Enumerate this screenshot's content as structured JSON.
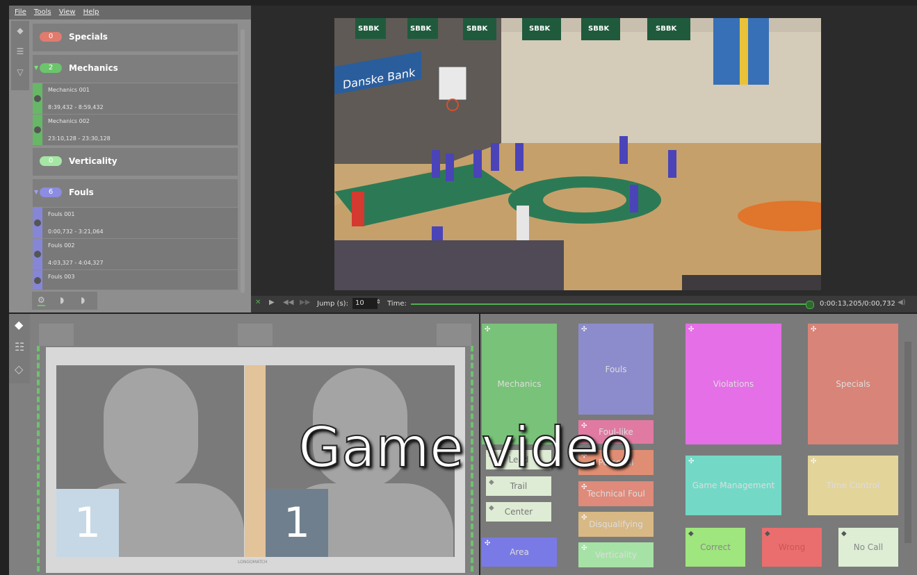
{
  "menu": [
    "File",
    "Tools",
    "View",
    "Help"
  ],
  "categories": [
    {
      "badge": "0",
      "name": "Specials",
      "color": "#e07b6e"
    },
    {
      "badge": "2",
      "name": "Mechanics",
      "color": "#6cc46c"
    },
    {
      "badge": "0",
      "name": "Verticality",
      "color": "#a5e6a5"
    },
    {
      "badge": "6",
      "name": "Fouls",
      "color": "#8c8ce0"
    }
  ],
  "events": [
    {
      "name": "Mechanics 001",
      "time": "8:39,432 - 8:59,432",
      "color": "#66b866"
    },
    {
      "name": "Mechanics 002",
      "time": "23:10,128 - 23:30,128",
      "color": "#66b866"
    },
    {
      "name": "Fouls 001",
      "time": "0:00,732 - 3:21,064",
      "color": "#8686d6"
    },
    {
      "name": "Fouls 002",
      "time": "4:03,327 - 4:04,327",
      "color": "#8686d6"
    },
    {
      "name": "Fouls 003",
      "time": "",
      "color": "#8686d6"
    }
  ],
  "controls": {
    "jump_label": "Jump (s):",
    "jump_value": "10",
    "time_label": "Time:",
    "time_readout": "0:00:13,205/0:00,732"
  },
  "video": {
    "banners": [
      "SBBK",
      "SBBK",
      "SBBK",
      "SBBK",
      "SBBK",
      "SBBK"
    ],
    "sponsor": "Danske Bank"
  },
  "court": {
    "left_number": "1",
    "right_number": "1",
    "logo": "LONGOMATCH"
  },
  "tag_buttons": [
    {
      "id": "mechanics",
      "label": "Mechanics",
      "color": "#79c279"
    },
    {
      "id": "fouls",
      "label": "Fouls",
      "color": "#8c8ccc"
    },
    {
      "id": "violations",
      "label": "Violations",
      "color": "#e56fe6"
    },
    {
      "id": "specials",
      "label": "Specials",
      "color": "#d98478"
    },
    {
      "id": "foul-like",
      "label": "Foul-like",
      "color": "#e07aa2"
    },
    {
      "id": "personal",
      "label": "Personal",
      "color": "#e08e73"
    },
    {
      "id": "technical-foul",
      "label": "Technical Foul",
      "color": "#df8a7a"
    },
    {
      "id": "disqualifying",
      "label": "Disqualifying",
      "color": "#d8b884"
    },
    {
      "id": "verticality",
      "label": "Verticality",
      "color": "#a6e2a6"
    },
    {
      "id": "game-management",
      "label": "Game Management",
      "color": "#73d9c6"
    },
    {
      "id": "time-control",
      "label": "Time Control",
      "color": "#e3d49a"
    },
    {
      "id": "area",
      "label": "Area",
      "color": "#7a7ae6"
    }
  ],
  "position_tags": [
    {
      "label": "Lead"
    },
    {
      "label": "Trail"
    },
    {
      "label": "Center"
    }
  ],
  "result_tags": [
    {
      "label": "Correct",
      "color": "#9fe67e"
    },
    {
      "label": "Wrong",
      "color": "#ea6e6e"
    },
    {
      "label": "No Call",
      "color": "#ddeed5"
    }
  ],
  "overlay_title": "Game video"
}
